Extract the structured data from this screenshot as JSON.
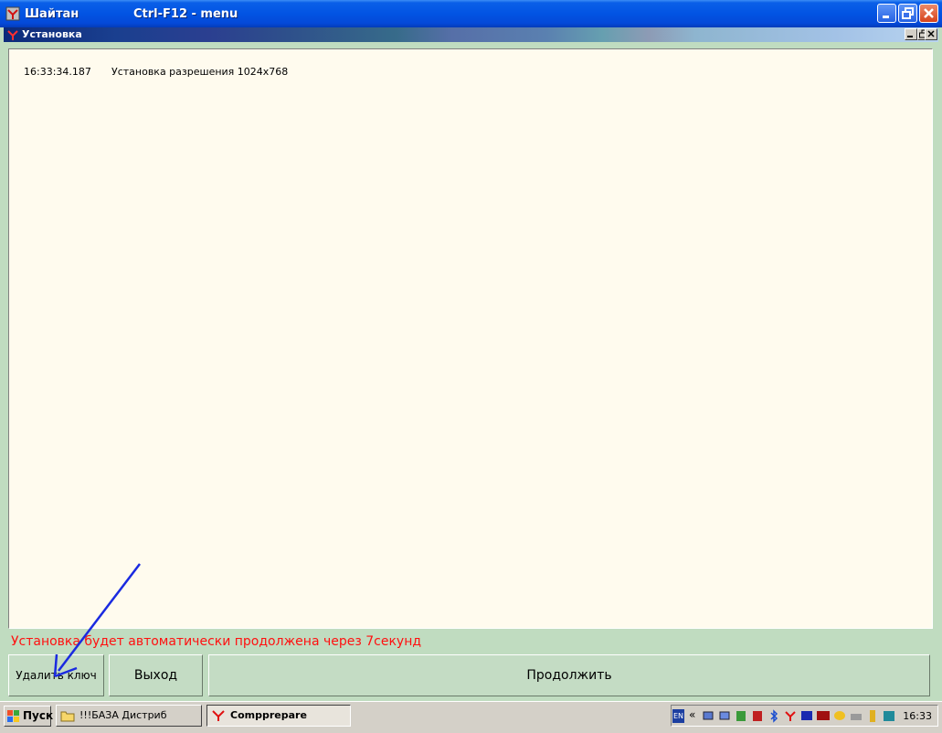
{
  "window": {
    "title": "Шайтан",
    "hint": "Ctrl-F12 - menu"
  },
  "mdi": {
    "title": "Установка"
  },
  "log": {
    "entries": [
      {
        "time": "16:33:34.187",
        "message": "Установка разрешения 1024x768"
      }
    ]
  },
  "status": {
    "text": "Установка будет автоматически продолжена через 7секунд"
  },
  "buttons": {
    "delete_key": "Удалить ключ",
    "exit": "Выход",
    "continue": "Продолжить"
  },
  "taskbar": {
    "start_label": "Пуск",
    "tasks": [
      {
        "label": "!!!БАЗА Дистриб",
        "icon": "folder-icon"
      },
      {
        "label": "Compprepare",
        "icon": "app-icon"
      }
    ],
    "tray": {
      "language": "EN",
      "clock": "16:33"
    }
  },
  "colors": {
    "status_text": "#ff1010",
    "app_background": "#c0dcc0",
    "log_background": "#fffbee",
    "annotation_arrow": "#1a2ae0"
  }
}
